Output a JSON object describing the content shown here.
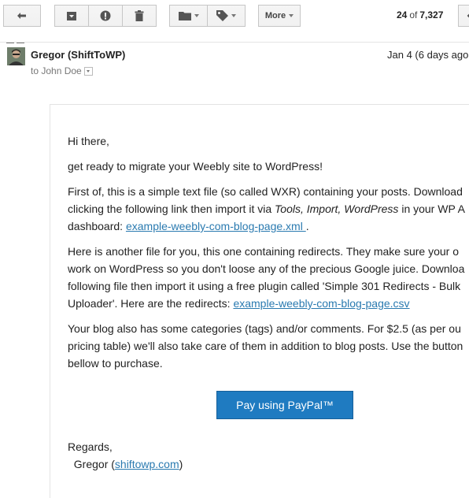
{
  "toolbar": {
    "back_icon": "reply-arrow-icon",
    "archive_icon": "archive-icon",
    "spam_icon": "report-spam-icon",
    "delete_icon": "trash-icon",
    "move_icon": "folder-icon",
    "labels_icon": "label-tag-icon",
    "more_label": "More",
    "count_current": "24",
    "count_of": "of",
    "count_total": "7,327"
  },
  "header": {
    "sender": "Gregor (ShiftToWP)",
    "date": "Jan 4 (6 days ago",
    "to": "to John Doe"
  },
  "email": {
    "greeting": "Hi there,",
    "intro": "get ready to migrate your Weebly site to WordPress!",
    "p1_line1": "First of, this is a simple text file (so called WXR) containing your posts. Download",
    "p1_line2_a": "clicking the following link then import it via ",
    "p1_line2_italic": "Tools, Import, WordPress",
    "p1_line2_b": " in your WP A",
    "p1_line3_a": "dashboard: ",
    "p1_link": "example-weebly-com-blog-page.xml ",
    "p1_line3_b": ".",
    "p2_line1": "Here is another file for you, this one containing redirects. They make sure your o",
    "p2_line2": "work on WordPress so you don't loose any of the precious Google juice. Downloa",
    "p2_line3": "following file then import it using a free plugin called 'Simple 301 Redirects - Bulk",
    "p2_line4_a": "Uploader'. Here are the redirects: ",
    "p2_link": "example-weebly-com-blog-page.csv",
    "p3_line1": "Your blog also has some categories (tags) and/or comments. For $2.5 (as per ou",
    "p3_line2": "pricing table) we'll also take care of them in addition to blog posts. Use the button",
    "p3_line3": "bellow to purchase.",
    "paypal_button": "Pay using PayPal™",
    "regards": "Regards,",
    "signature_name": "Gregor (",
    "signature_link": "shiftowp.com",
    "signature_end": ")"
  }
}
